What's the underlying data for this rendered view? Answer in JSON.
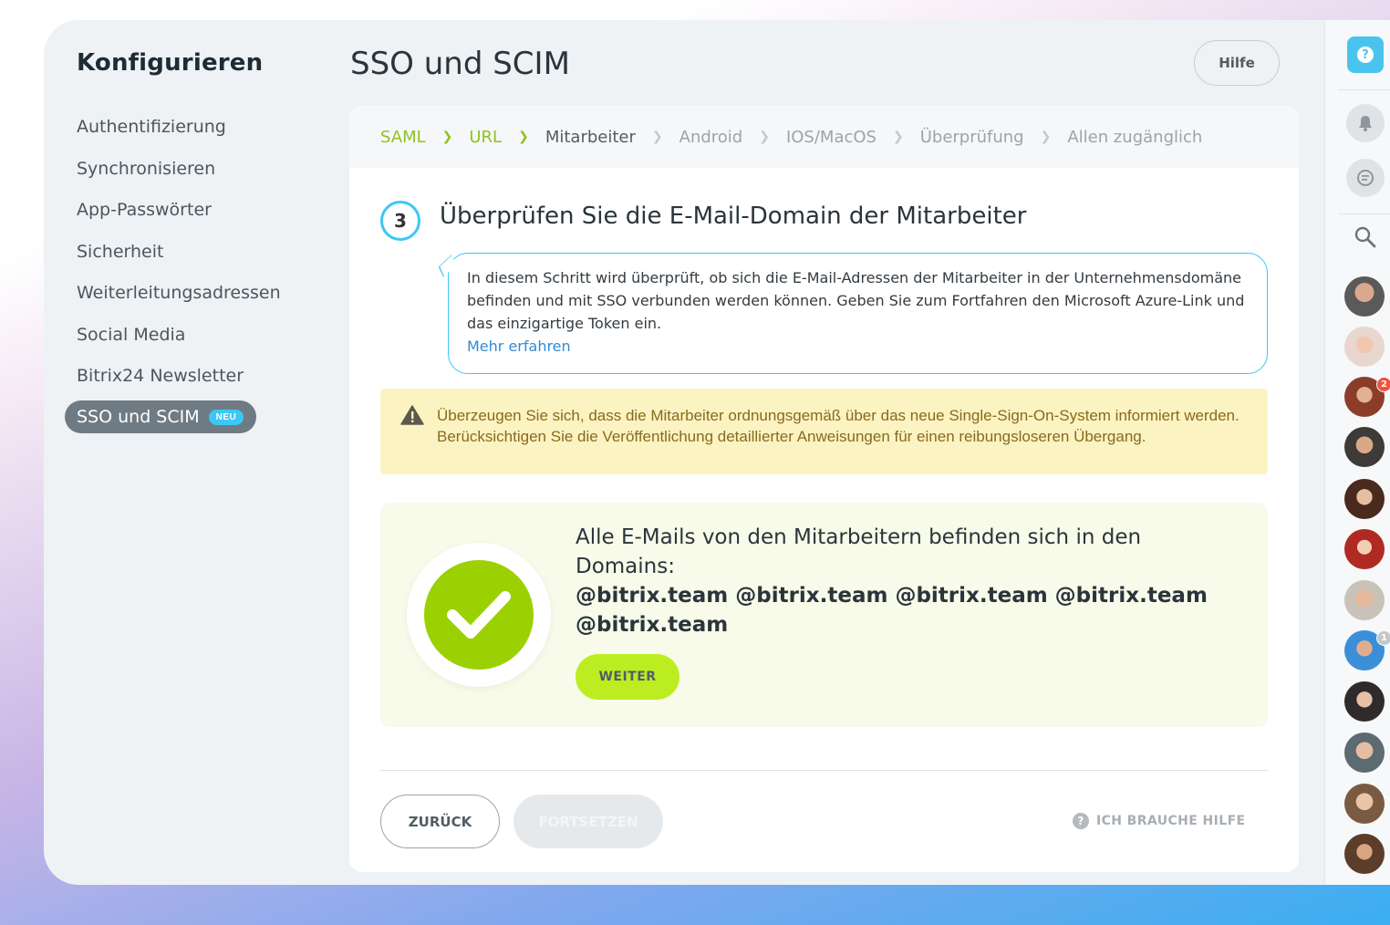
{
  "sidebar": {
    "title": "Konfigurieren",
    "items": [
      {
        "label": "Authentifizierung"
      },
      {
        "label": "Synchronisieren"
      },
      {
        "label": "App-Passwörter"
      },
      {
        "label": "Sicherheit"
      },
      {
        "label": "Weiterleitungsadressen"
      },
      {
        "label": "Social Media"
      },
      {
        "label": "Bitrix24 Newsletter"
      }
    ],
    "active_item": {
      "label": "SSO und SCIM",
      "badge": "NEU"
    }
  },
  "header": {
    "title": "SSO und SCIM",
    "help_label": "Hilfe"
  },
  "steps": [
    {
      "label": "SAML",
      "state": "done"
    },
    {
      "label": "URL",
      "state": "done"
    },
    {
      "label": "Mitarbeiter",
      "state": "current"
    },
    {
      "label": "Android",
      "state": "pending"
    },
    {
      "label": "IOS/MacOS",
      "state": "pending"
    },
    {
      "label": "Überprüfung",
      "state": "pending"
    },
    {
      "label": "Allen zugänglich",
      "state": "pending"
    }
  ],
  "step": {
    "number": "3",
    "heading": "Überprüfen Sie die E-Mail-Domain der Mitarbeiter",
    "info_text": "In diesem Schritt wird überprüft, ob sich die E-Mail-Adressen der Mitarbeiter in der Unternehmensdomäne befinden und mit SSO verbunden werden können. Geben Sie zum Fortfahren den Microsoft Azure-Link und das einzigartige Token ein.",
    "info_link": "Mehr erfahren"
  },
  "warning": {
    "icon": "warning-triangle-icon",
    "text": "Überzeugen Sie sich, dass die Mitarbeiter ordnungsgemäß über das neue Single-Sign-On-System informiert werden. Berücksichtigen Sie die Veröffentlichung detaillierter Anweisungen für einen reibungsloseren Übergang."
  },
  "result": {
    "text": "Alle E-Mails von den Mitarbeitern befinden sich in den Domains:",
    "domains": "@bitrix.team @bitrix.team @bitrix.team @bitrix.team @bitrix.team",
    "next_label": "WEITER"
  },
  "footer": {
    "back_label": "ZURÜCK",
    "continue_label": "FORTSETZEN",
    "help_label": "ICH BRAUCHE HILFE"
  },
  "rightbar": {
    "help_icon": "?",
    "avatar_badges": [
      {
        "index": 2,
        "value": "2"
      },
      {
        "index": 7,
        "value": "1"
      }
    ]
  },
  "colors": {
    "accent_blue": "#3bc8f5",
    "accent_green": "#9bd103",
    "button_green": "#bbed21",
    "warning_bg": "#fbf3c2",
    "warning_text": "#8a6a1d"
  }
}
